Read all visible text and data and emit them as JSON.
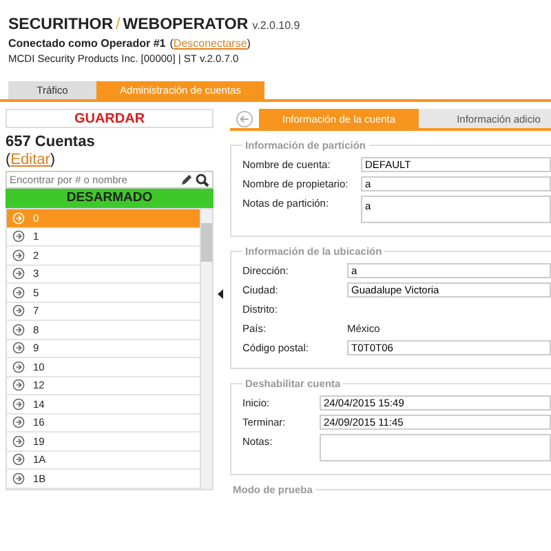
{
  "header": {
    "brand_left": "SECURITHOR",
    "separator": "/",
    "brand_right": "WEBOPERATOR",
    "version": "v.2.0.10.9",
    "connection": "Conectado como Operador #1",
    "paren_open": "(",
    "logout_link": "Desconectarse",
    "paren_close": ")",
    "company": "MCDI Security Products Inc. [00000] | ST v.2.0.7.0"
  },
  "tabs": [
    {
      "label": "Tráfico",
      "selected": false
    },
    {
      "label": "Administración de cuentas",
      "selected": true
    }
  ],
  "sidebar": {
    "save_button": "GUARDAR",
    "count": "657 Cuentas",
    "edit_open": "(",
    "edit_link": "Editar",
    "edit_close": ")",
    "search": {
      "placeholder": "Encontrar por # o nombre"
    },
    "status": "DESARMADO",
    "accounts": [
      {
        "label": "0",
        "selected": true
      },
      {
        "label": "1",
        "selected": false
      },
      {
        "label": "2",
        "selected": false
      },
      {
        "label": "3",
        "selected": false
      },
      {
        "label": "5",
        "selected": false
      },
      {
        "label": "7",
        "selected": false
      },
      {
        "label": "8",
        "selected": false
      },
      {
        "label": "9",
        "selected": false
      },
      {
        "label": "10",
        "selected": false
      },
      {
        "label": "12",
        "selected": false
      },
      {
        "label": "14",
        "selected": false
      },
      {
        "label": "16",
        "selected": false
      },
      {
        "label": "19",
        "selected": false
      },
      {
        "label": "1A",
        "selected": false
      },
      {
        "label": "1B",
        "selected": false
      }
    ]
  },
  "subtabs": [
    {
      "label": "Información de la cuenta",
      "selected": true
    },
    {
      "label": "Información adicio",
      "selected": false
    }
  ],
  "sections": [
    {
      "title": "Información de partición",
      "fields": [
        {
          "kind": "input",
          "label": "Nombre de cuenta:",
          "value": "DEFAULT"
        },
        {
          "kind": "input",
          "label": "Nombre de propietario:",
          "value": "a"
        },
        {
          "kind": "textarea",
          "label": "Notas de partición:",
          "value": "a"
        }
      ]
    },
    {
      "title": "Información de la ubicación",
      "fields": [
        {
          "kind": "input",
          "label": "Dirección:",
          "value": "a"
        },
        {
          "kind": "input",
          "label": "Ciudad:",
          "value": "Guadalupe Victoria"
        },
        {
          "kind": "text",
          "label": "Distrito:"
        },
        {
          "kind": "text",
          "label": "País:",
          "value": "México"
        },
        {
          "kind": "input",
          "label": "Código postal:",
          "value": "T0T0T06"
        }
      ]
    },
    {
      "title": "Deshabilitar cuenta",
      "fields": [
        {
          "kind": "input",
          "label": "Inicio:",
          "value": "24/04/2015 15:49"
        },
        {
          "kind": "input",
          "label": "Terminar:",
          "value": "24/09/2015 11:45"
        },
        {
          "kind": "textarea",
          "label": "Notas:"
        }
      ]
    },
    {
      "title": "Modo de prueba"
    }
  ]
}
